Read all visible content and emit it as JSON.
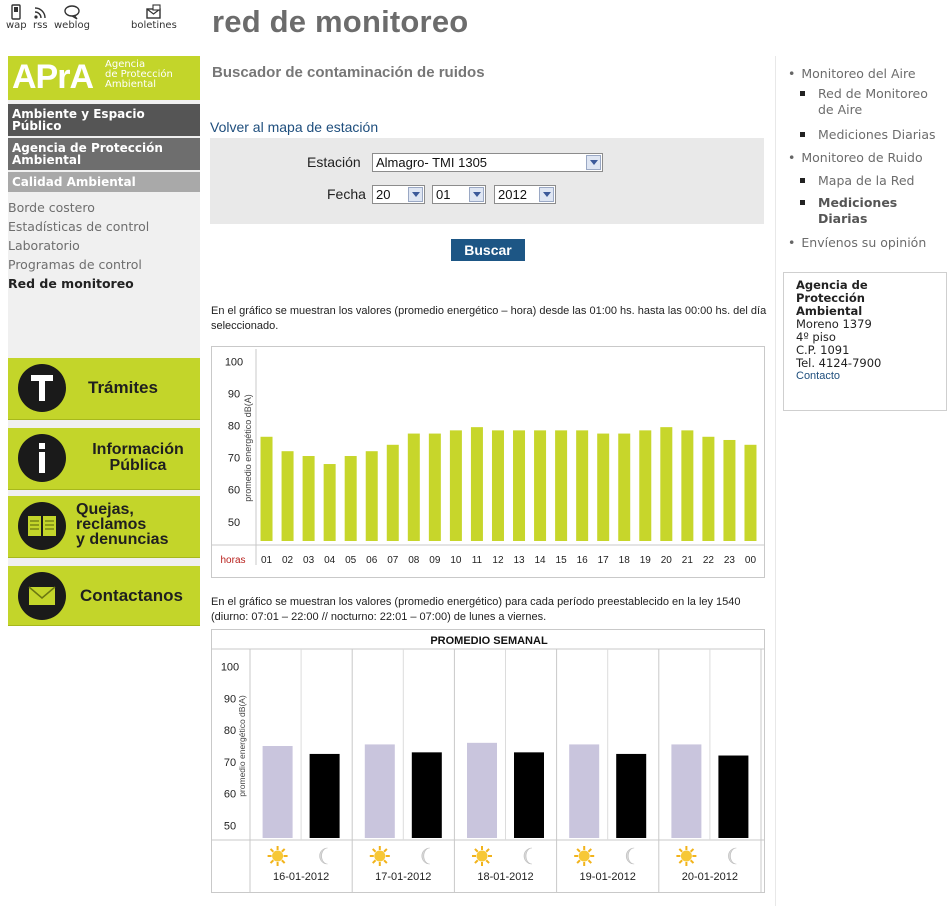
{
  "utility_links": [
    {
      "label": "wap",
      "icon": "mobile-phone-icon"
    },
    {
      "label": "rss",
      "icon": "rss-icon"
    },
    {
      "label": "weblog",
      "icon": "speech-bubble-icon"
    },
    {
      "label": "boletines",
      "icon": "newsletter-icon"
    }
  ],
  "page_title": "red de monitoreo",
  "logo": {
    "brand": "APrA",
    "line1": "Agencia",
    "line2": "de Protección",
    "line3": "Ambiental"
  },
  "left_sections": {
    "section1": "Ambiente y Espacio Público",
    "section2": "Agencia de Protección Ambiental",
    "section3": "Calidad Ambiental"
  },
  "subnav": [
    {
      "label": "Borde costero",
      "active": false
    },
    {
      "label": "Estadísticas de control",
      "active": false
    },
    {
      "label": "Laboratorio",
      "active": false
    },
    {
      "label": "Programas de control",
      "active": false
    },
    {
      "label": "Red de monitoreo",
      "active": true
    }
  ],
  "big_buttons": {
    "tramites": "Trámites",
    "info_line1": "Información",
    "info_line2": "Pública",
    "quejas_line1": "Quejas,",
    "quejas_line2": "reclamos",
    "quejas_line3": "y denuncias",
    "contacto": "Contactanos"
  },
  "search": {
    "subtitle": "Buscador de contaminación de ruidos",
    "back_link": "Volver al mapa de estación",
    "station_label": "Estación",
    "station_value": "Almagro- TMI 1305",
    "date_label": "Fecha",
    "day_value": "20",
    "month_value": "01",
    "year_value": "2012",
    "submit_label": "Buscar"
  },
  "descriptions": {
    "hourly": "En el gráfico se muestran los valores (promedio energético – hora) desde las 01:00 hs. hasta las 00:00 hs. del día seleccionado.",
    "weekly": "En el gráfico se muestran los valores (promedio energético) para cada período preestablecido en la ley 1540 (diurno: 07:01 – 22:00 // nocturno: 22:01 – 07:00) de lunes a viernes."
  },
  "right_nav": {
    "aire": "Monitoreo del Aire",
    "aire_red_1": "Red de Monitoreo",
    "aire_red_2": "de Aire",
    "aire_mediciones": "Mediciones Diarias",
    "ruido": "Monitoreo de Ruido",
    "ruido_mapa": "Mapa de la Red",
    "ruido_med_1": "Mediciones",
    "ruido_med_2": "Diarias",
    "opinion": "Envíenos su opinión"
  },
  "contact": {
    "org1": "Agencia de",
    "org2": "Protección",
    "org3": "Ambiental",
    "address": "Moreno 1379",
    "floor": "4º piso",
    "cp": "C.P. 1091",
    "tel": "Tel. 4124-7900",
    "link": "Contacto"
  },
  "chart_data": [
    {
      "type": "bar",
      "title": "",
      "xlabel": "horas",
      "ylabel": "promedio energético dB(A)",
      "ylim": [
        44,
        102
      ],
      "yticks": [
        50,
        60,
        70,
        80,
        90,
        100
      ],
      "categories": [
        "01",
        "02",
        "03",
        "04",
        "05",
        "06",
        "07",
        "08",
        "09",
        "10",
        "11",
        "12",
        "13",
        "14",
        "15",
        "16",
        "17",
        "18",
        "19",
        "20",
        "21",
        "22",
        "23",
        "00"
      ],
      "values": [
        76.5,
        72,
        70.5,
        68,
        70.5,
        72,
        74,
        77.5,
        77.5,
        78.5,
        79.5,
        78.5,
        78.5,
        78.5,
        78.5,
        78.5,
        77.5,
        77.5,
        78.5,
        79.5,
        78.5,
        76.5,
        75.5,
        74
      ],
      "color": "#c7d62b",
      "grid": false
    },
    {
      "type": "bar",
      "title": "PROMEDIO SEMANAL",
      "xlabel": "",
      "ylabel": "promedio energético dB(A)",
      "ylim": [
        46,
        104
      ],
      "yticks": [
        50,
        60,
        70,
        80,
        90,
        100
      ],
      "categories": [
        "16-01-2012",
        "17-01-2012",
        "18-01-2012",
        "19-01-2012",
        "20-01-2012"
      ],
      "series": [
        {
          "period": "diurno",
          "icon": "sun-icon",
          "color": "#c9c5dd",
          "values": [
            75,
            75.5,
            76,
            75.5,
            75.5
          ]
        },
        {
          "period": "nocturno",
          "icon": "moon-icon",
          "color": "#000000",
          "values": [
            72.5,
            73,
            73,
            72.5,
            72
          ]
        }
      ],
      "grid": false
    }
  ]
}
